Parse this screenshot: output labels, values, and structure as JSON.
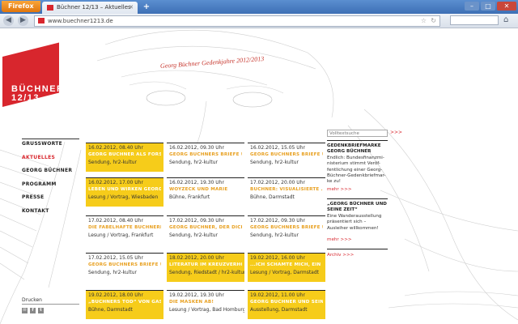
{
  "browser": {
    "app_button": "Firefox",
    "tab_title": "Büchner 12/13 – Aktuelles",
    "new_tab": "+",
    "url": "www.buechner1213.de"
  },
  "logo": {
    "line1": "BÜCHNER",
    "line2": "12/13"
  },
  "tagline": "Georg Büchner Gedenkjahre 2012/2013",
  "menu": [
    "GRUSSWORTE",
    "AKTUELLES",
    "GEORG BÜCHNER",
    "PROGRAMM",
    "PRESSE",
    "KONTAKT"
  ],
  "print_label": "Drucken",
  "share": [
    "✉",
    "f",
    "t"
  ],
  "events": [
    [
      {
        "date": "16.02.2012, 08.40 Uhr",
        "title": "GEORG BÜCHNER ALS FORS...",
        "sub": "Sendung, hr2-kultur",
        "style": "yellow"
      },
      {
        "date": "16.02.2012, 09.30 Uhr",
        "title": "GEORG BÜCHNERS BRIEFE U...",
        "sub": "Sendung, hr2-kultur",
        "style": "white"
      },
      {
        "date": "16.02.2012, 15.05 Uhr",
        "title": "GEORG BÜCHNERS BRIEFE U...",
        "sub": "Sendung, hr2-kultur",
        "style": "white"
      }
    ],
    [
      {
        "date": "16.02.2012, 17.00 Uhr",
        "title": "LEBEN UND WIRKEN GEORG ...",
        "sub": "Lesung / Vortrag, Wiesbaden",
        "style": "yellow"
      },
      {
        "date": "16.02.2012, 19.30 Uhr",
        "title": "WOYZECK UND MARIE",
        "sub": "Bühne, Frankfurt",
        "style": "white"
      },
      {
        "date": "17.02.2012, 20.00 Uhr",
        "title": "BÜCHNER: VISUALISIERTE ...",
        "sub": "Bühne, Darmstadt",
        "style": "white"
      }
    ],
    [
      {
        "date": "17.02.2012, 08.40 Uhr",
        "title": "DIE FABELHAFTE BÜCHNERB...",
        "sub": "Lesung / Vortrag, Frankfurt",
        "style": "white"
      },
      {
        "date": "17.02.2012, 09.30 Uhr",
        "title": "GEORG BÜCHNER, DER DICH...",
        "sub": "Sendung, hr2-kultur",
        "style": "white"
      },
      {
        "date": "17.02.2012, 09.30 Uhr",
        "title": "GEORG BÜCHNERS BRIEFE U...",
        "sub": "Sendung, hr2-kultur",
        "style": "white"
      }
    ],
    [
      {
        "date": "17.02.2012, 15.05 Uhr",
        "title": "GEORG BÜCHNERS BRIEFE U...",
        "sub": "Sendung, hr2-kultur",
        "style": "white"
      },
      {
        "date": "18.02.2012, 20.00 Uhr",
        "title": "LITERATUR IM KREUZVERHÖR",
        "sub": "Sendung, Riedstadt / hr2-kultur",
        "style": "yellow"
      },
      {
        "date": "19.02.2012, 16.00 Uhr",
        "title": "...ICH SCHÄMTE MICH, EIN ...",
        "sub": "Lesung / Vortrag, Darmstadt",
        "style": "yellow"
      }
    ],
    [
      {
        "date": "19.02.2012, 18.00 Uhr",
        "title": "„BÜCHNERS TOD“ VON GAS...",
        "sub": "Bühne, Darmstadt",
        "style": "yellow"
      },
      {
        "date": "19.02.2012, 19.30 Uhr",
        "title": "DIE MASKEN AB!",
        "sub": "Lesung / Vortrag, Bad Homburg v.d.Höhe",
        "style": "white"
      },
      {
        "date": "19.02.2012, 11.00 Uhr",
        "title": "GEORG BÜCHNER UND SEIN...",
        "sub": "Ausstellung, Darmstadt",
        "style": "yellow"
      }
    ]
  ],
  "sidebar": {
    "search_placeholder": "Volltextsuche",
    "search_go": ">>>",
    "news1_title": "GEDENKBRIEFMARKE GEORG BÜCHNER",
    "news1_text": "Endlich: Bundesfinanzmi-nisterium stimmt Veröf-fentlichung einer Georg-Büchner-Gedenkbriefmar-ke zu!",
    "news1_more": "mehr >>>",
    "news2_title": "„GEORG BÜCHNER UND SEINE ZEIT“",
    "news2_text": "Eine Wanderausstellung präsentiert sich – Ausleiher willkommen!",
    "news2_more": "mehr >>>",
    "archive": "Archiv >>>"
  },
  "colors": {
    "red": "#d8262d",
    "yellow": "#f6cc1a",
    "orange_text": "#e8a020"
  }
}
